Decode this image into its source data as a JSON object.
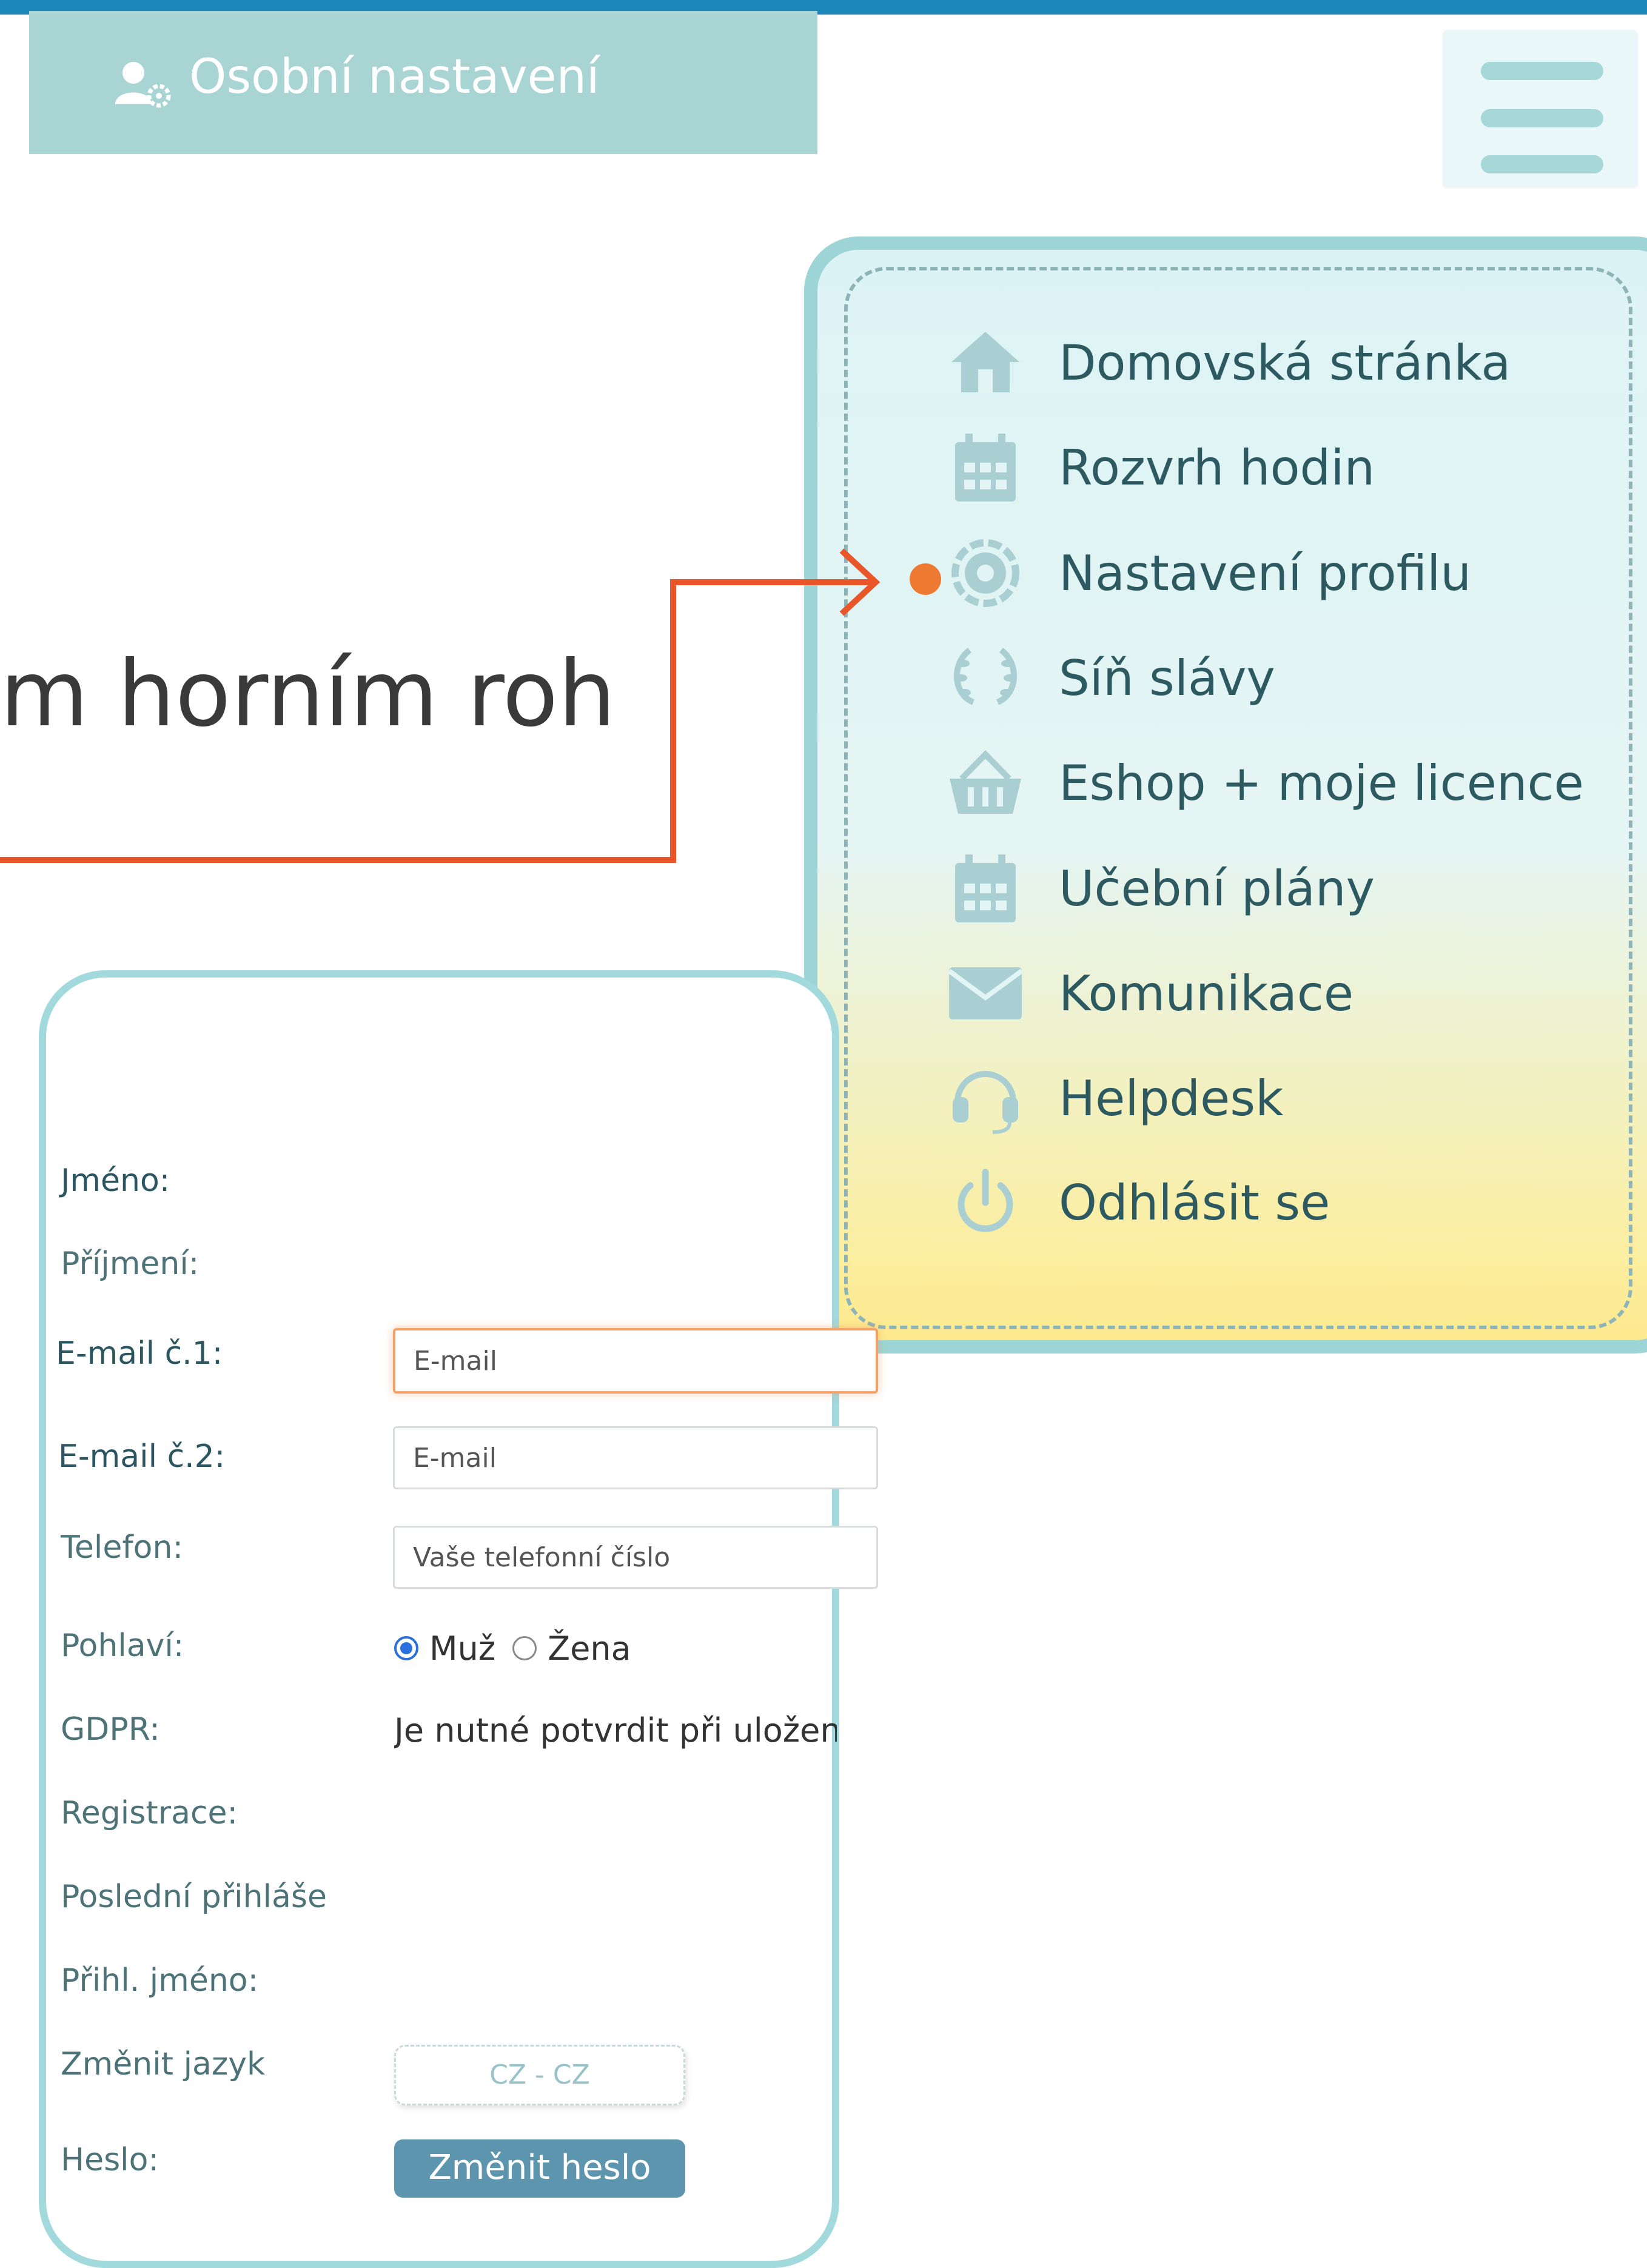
{
  "headline": {
    "text": "m horním rohu."
  },
  "hamburger": {
    "icon": "hamburger-menu-icon"
  },
  "menu": {
    "items": [
      {
        "label": "Domovská stránka",
        "icon": "home-icon"
      },
      {
        "label": "Rozvrh hodin",
        "icon": "calendar-icon"
      },
      {
        "label": "Nastavení profilu",
        "icon": "gear-icon",
        "active": true
      },
      {
        "label": "Síň slávy",
        "icon": "laurel-wreath-icon"
      },
      {
        "label": "Eshop + moje licence",
        "icon": "shopping-basket-icon"
      },
      {
        "label": "Učební plány",
        "icon": "calendar-icon"
      },
      {
        "label": "Komunikace",
        "icon": "envelope-icon"
      },
      {
        "label": "Helpdesk",
        "icon": "headset-icon"
      },
      {
        "label": "Odhlásit se",
        "icon": "power-icon"
      }
    ]
  },
  "settings": {
    "title": "Osobní nastavení",
    "labels": {
      "first_name": "Jméno:",
      "last_name": "Příjmení:",
      "email1": "E-mail č.1:",
      "email2": "E-mail č.2:",
      "phone": "Telefon:",
      "gender": "Pohlaví:",
      "gdpr": "GDPR:",
      "registration": "Registrace:",
      "last_login": "Poslední přihláše",
      "login_name": "Přihl. jméno:",
      "change_language": "Změnit jazyk",
      "password": "Heslo:"
    },
    "email1_placeholder": "E-mail",
    "email2_placeholder": "E-mail",
    "phone_placeholder": "Vaše telefonní číslo",
    "gender_options": [
      "Muž",
      "Žena"
    ],
    "gender_selected": "Muž",
    "gdpr_text": "Je nutné potvrdit při uložení",
    "language_button": "CZ - CZ",
    "change_password_button": "Změnit heslo"
  },
  "colors": {
    "top_bar": "#1b86b8",
    "arrow": "#e8562a",
    "active_dot": "#ee7a32",
    "panel_border": "#9dd4d6",
    "card_header": "#a8d4d4",
    "menu_text": "#2d5961",
    "password_button": "#5d95ae"
  }
}
